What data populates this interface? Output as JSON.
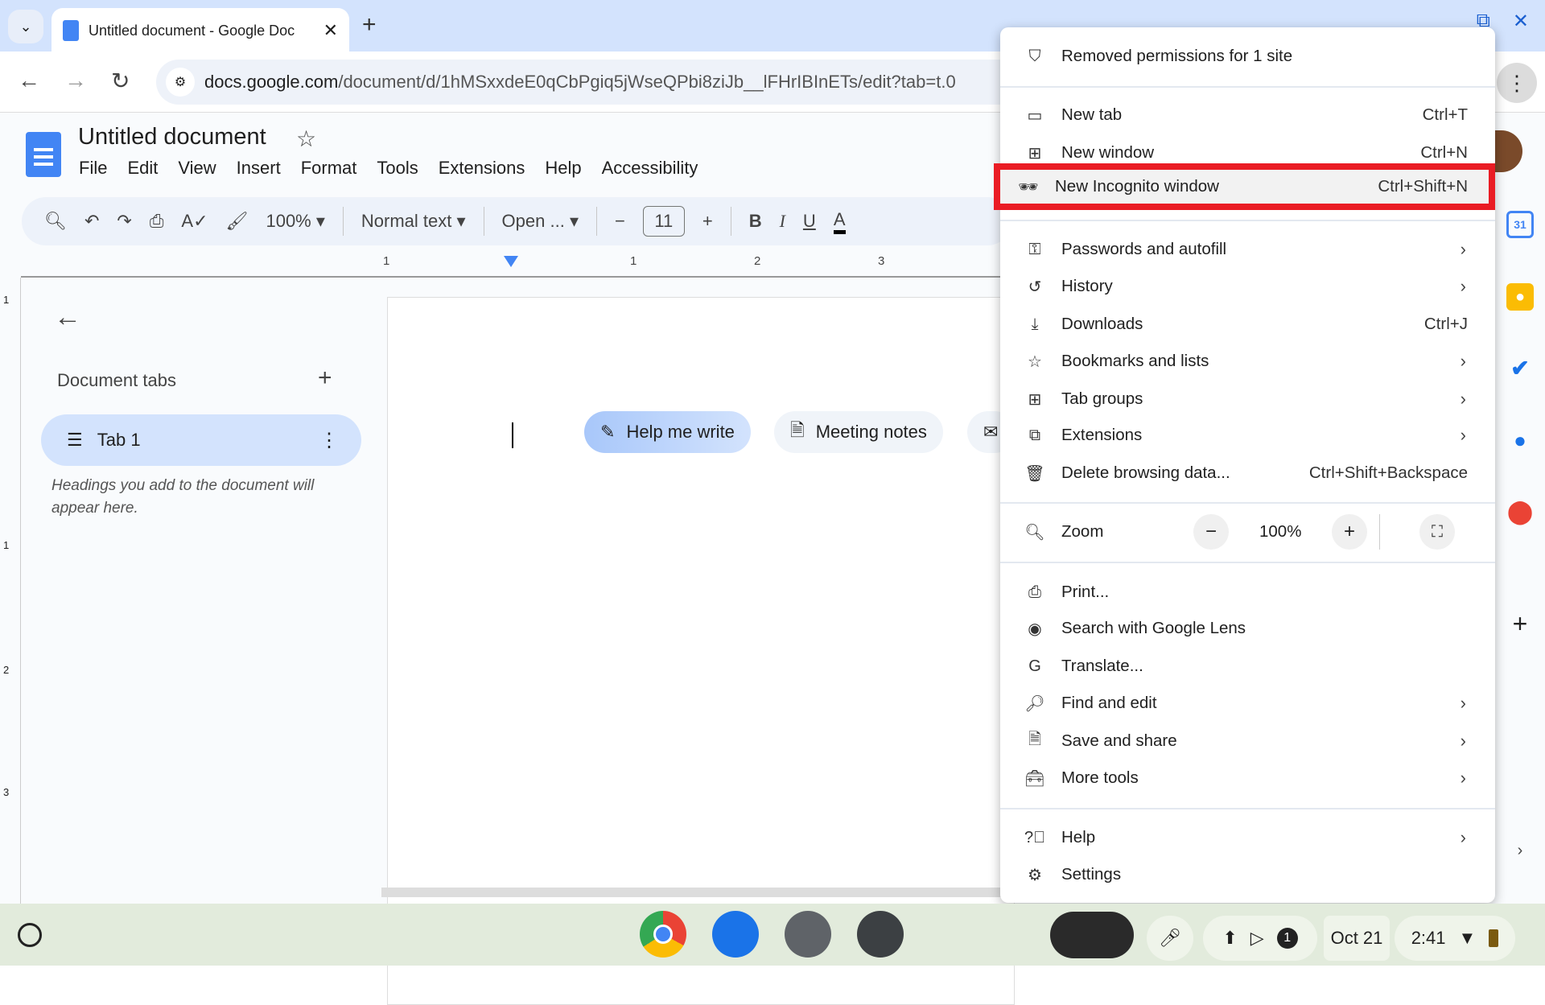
{
  "browser": {
    "tab_title": "Untitled document - Google Doc",
    "url_host": "docs.google.com",
    "url_path": "/document/d/1hMSxxdeE0qCbPgiq5jWseQPbi8ziJb__lFHrIBInETs/edit?tab=t.0"
  },
  "docs": {
    "title": "Untitled document",
    "menus": [
      "File",
      "Edit",
      "View",
      "Insert",
      "Format",
      "Tools",
      "Extensions",
      "Help",
      "Accessibility"
    ],
    "toolbar": {
      "zoom": "100%",
      "style": "Normal text",
      "font": "Open ...",
      "font_size": "11"
    },
    "ruler_labels": [
      "1",
      "1",
      "2",
      "3"
    ],
    "vruler_labels": [
      "1",
      "1",
      "2",
      "3"
    ],
    "panel": {
      "heading": "Document tabs",
      "tab_label": "Tab 1",
      "hint": "Headings you add to the document will appear here."
    },
    "chips": {
      "help_me_write": "Help me write",
      "meeting_notes": "Meeting notes"
    }
  },
  "menu": {
    "header": "Removed permissions for 1 site",
    "items": [
      {
        "label": "New tab",
        "shortcut": "Ctrl+T",
        "icon": "new-tab-icon"
      },
      {
        "label": "New window",
        "shortcut": "Ctrl+N",
        "icon": "new-window-icon"
      },
      {
        "label": "New Incognito window",
        "shortcut": "Ctrl+Shift+N",
        "icon": "incognito-icon",
        "highlighted": true
      },
      {
        "label": "Passwords and autofill",
        "submenu": true,
        "icon": "key-icon"
      },
      {
        "label": "History",
        "submenu": true,
        "icon": "history-icon"
      },
      {
        "label": "Downloads",
        "shortcut": "Ctrl+J",
        "icon": "download-icon"
      },
      {
        "label": "Bookmarks and lists",
        "submenu": true,
        "icon": "star-icon"
      },
      {
        "label": "Tab groups",
        "submenu": true,
        "icon": "tab-groups-icon"
      },
      {
        "label": "Extensions",
        "submenu": true,
        "icon": "extension-icon"
      },
      {
        "label": "Delete browsing data...",
        "shortcut": "Ctrl+Shift+Backspace",
        "icon": "trash-icon"
      },
      {
        "label": "Print...",
        "icon": "print-icon"
      },
      {
        "label": "Search with Google Lens",
        "icon": "lens-icon"
      },
      {
        "label": "Translate...",
        "icon": "translate-icon"
      },
      {
        "label": "Find and edit",
        "submenu": true,
        "icon": "find-icon"
      },
      {
        "label": "Save and share",
        "submenu": true,
        "icon": "save-icon"
      },
      {
        "label": "More tools",
        "submenu": true,
        "icon": "toolbox-icon"
      },
      {
        "label": "Help",
        "submenu": true,
        "icon": "help-icon"
      },
      {
        "label": "Settings",
        "icon": "gear-icon"
      }
    ],
    "zoom": {
      "label": "Zoom",
      "value": "100%"
    }
  },
  "taskbar": {
    "date": "Oct 21",
    "time": "2:41",
    "notification_count": "1"
  },
  "colors": {
    "highlight_border": "#ea1c24",
    "accent": "#1a73e8"
  }
}
